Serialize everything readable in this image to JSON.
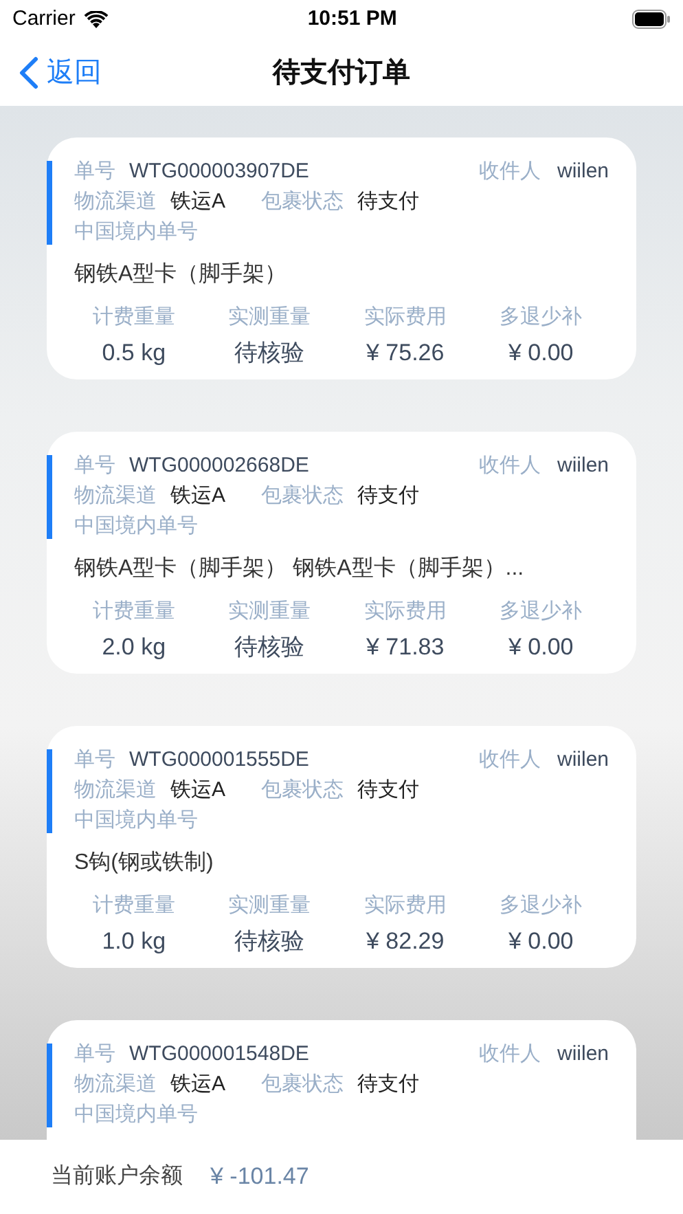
{
  "status_bar": {
    "carrier": "Carrier",
    "time": "10:51 PM"
  },
  "nav": {
    "back": "返回",
    "title": "待支付订单"
  },
  "orders": [
    {
      "no_label": "单号",
      "no": "WTG000003907DE",
      "receiver_label": "收件人",
      "receiver": "wiilen",
      "channel_label": "物流渠道",
      "channel": "铁运A",
      "status_label": "包裹状态",
      "status": "待支付",
      "domestic_label": "中国境内单号",
      "product": "钢铁A型卡（脚手架）",
      "stats": [
        {
          "label": "计费重量",
          "value": "0.5 kg"
        },
        {
          "label": "实测重量",
          "value": "待核验"
        },
        {
          "label": "实际费用",
          "value": "¥ 75.26"
        },
        {
          "label": "多退少补",
          "value": "¥ 0.00"
        }
      ]
    },
    {
      "no_label": "单号",
      "no": "WTG000002668DE",
      "receiver_label": "收件人",
      "receiver": "wiilen",
      "channel_label": "物流渠道",
      "channel": "铁运A",
      "status_label": "包裹状态",
      "status": "待支付",
      "domestic_label": "中国境内单号",
      "product": "钢铁A型卡（脚手架） 钢铁A型卡（脚手架）...",
      "stats": [
        {
          "label": "计费重量",
          "value": "2.0 kg"
        },
        {
          "label": "实测重量",
          "value": "待核验"
        },
        {
          "label": "实际费用",
          "value": "¥ 71.83"
        },
        {
          "label": "多退少补",
          "value": "¥ 0.00"
        }
      ]
    },
    {
      "no_label": "单号",
      "no": "WTG000001555DE",
      "receiver_label": "收件人",
      "receiver": "wiilen",
      "channel_label": "物流渠道",
      "channel": "铁运A",
      "status_label": "包裹状态",
      "status": "待支付",
      "domestic_label": "中国境内单号",
      "product": "S钩(钢或铁制)",
      "stats": [
        {
          "label": "计费重量",
          "value": "1.0 kg"
        },
        {
          "label": "实测重量",
          "value": "待核验"
        },
        {
          "label": "实际费用",
          "value": "¥ 82.29"
        },
        {
          "label": "多退少补",
          "value": "¥ 0.00"
        }
      ]
    },
    {
      "no_label": "单号",
      "no": "WTG000001548DE",
      "receiver_label": "收件人",
      "receiver": "wiilen",
      "channel_label": "物流渠道",
      "channel": "铁运A",
      "status_label": "包裹状态",
      "status": "待支付",
      "domestic_label": "中国境内单号"
    }
  ],
  "footer": {
    "balance_label": "当前账户余额",
    "balance": "¥ -101.47"
  }
}
